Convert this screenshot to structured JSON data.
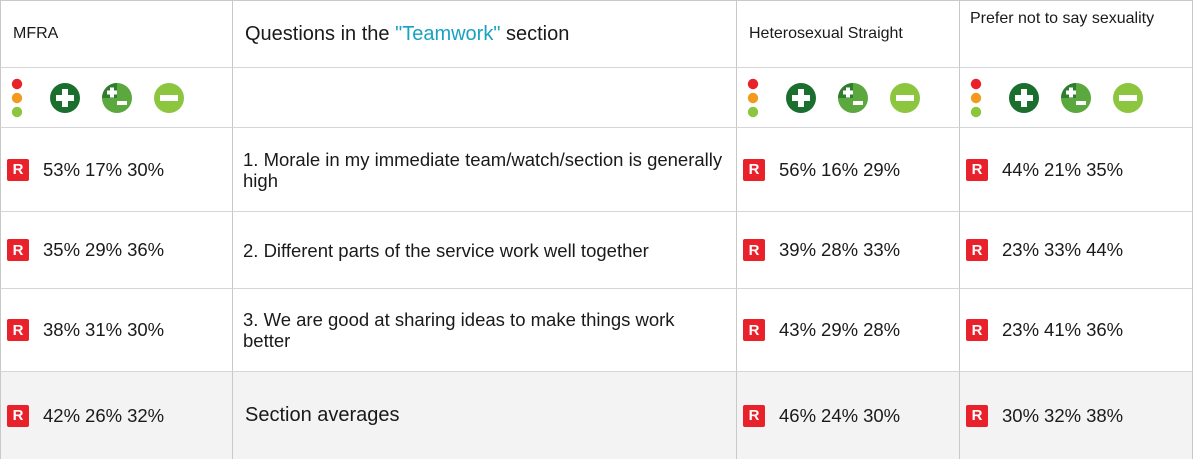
{
  "header": {
    "mfra": "MFRA",
    "q_prefix": "Questions in the ",
    "q_section": "\"Teamwork\"",
    "q_suffix": " section",
    "hetero": "Heterosexual Straight",
    "prefer": "Prefer not to say sexuality"
  },
  "icons": [
    "traffic-light-icon",
    "plus-circle-icon",
    "plus-minus-circle-icon",
    "minus-circle-icon"
  ],
  "colors": {
    "red": "#e8212b",
    "dark_green": "#1a6e2e",
    "mid_green": "#5aa83e",
    "light_green": "#8cc63f",
    "teal": "#17a3c0"
  },
  "badge": "R",
  "rows": [
    {
      "question": "1.  Morale in my immediate team/watch/section is generally high",
      "mfra": [
        "53%",
        "17%",
        "30%"
      ],
      "hetero": [
        "56%",
        "16%",
        "29%"
      ],
      "prefer": [
        "44%",
        "21%",
        "35%"
      ]
    },
    {
      "question": "2.  Different parts of the service work well together",
      "mfra": [
        "35%",
        "29%",
        "36%"
      ],
      "hetero": [
        "39%",
        "28%",
        "33%"
      ],
      "prefer": [
        "23%",
        "33%",
        "44%"
      ]
    },
    {
      "question": "3.  We are good at sharing ideas to make things work better",
      "mfra": [
        "38%",
        "31%",
        "30%"
      ],
      "hetero": [
        "43%",
        "29%",
        "28%"
      ],
      "prefer": [
        "23%",
        "41%",
        "36%"
      ]
    }
  ],
  "averages": {
    "label": "Section averages",
    "mfra": [
      "42%",
      "26%",
      "32%"
    ],
    "hetero": [
      "46%",
      "24%",
      "30%"
    ],
    "prefer": [
      "30%",
      "32%",
      "38%"
    ]
  }
}
